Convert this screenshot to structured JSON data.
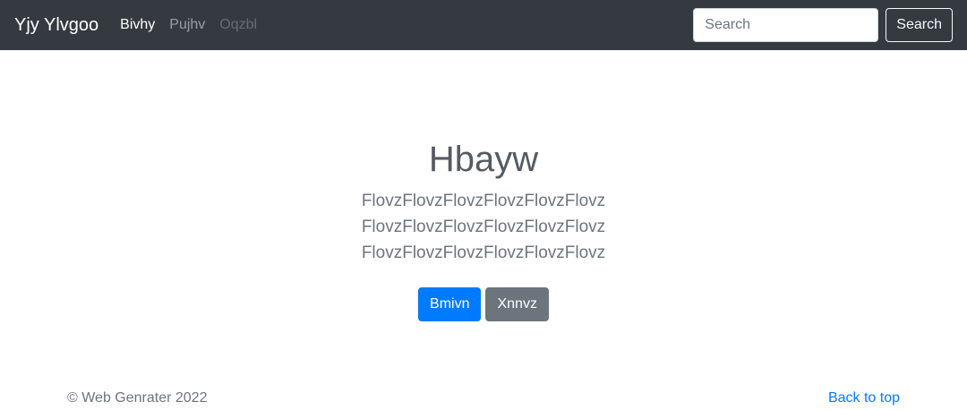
{
  "navbar": {
    "brand": "Yjy Ylvgoo",
    "links": [
      {
        "label": "Bivhy",
        "state": "active"
      },
      {
        "label": "Pujhv",
        "state": "normal"
      },
      {
        "label": "Oqzbl",
        "state": "disabled"
      }
    ],
    "search": {
      "placeholder": "Search",
      "value": "",
      "button_label": "Search"
    }
  },
  "hero": {
    "title": "Hbayw",
    "lead": "FlovzFlovzFlovzFlovzFlovzFlovz FlovzFlovzFlovzFlovzFlovzFlovz FlovzFlovzFlovzFlovzFlovzFlovz",
    "primary_button": "Bmivn",
    "secondary_button": "Xnnvz"
  },
  "footer": {
    "copyright": "© Web Genrater 2022",
    "back_to_top": "Back to top"
  },
  "colors": {
    "navbar_bg": "#343a40",
    "primary": "#007bff",
    "secondary": "#6c757d"
  }
}
